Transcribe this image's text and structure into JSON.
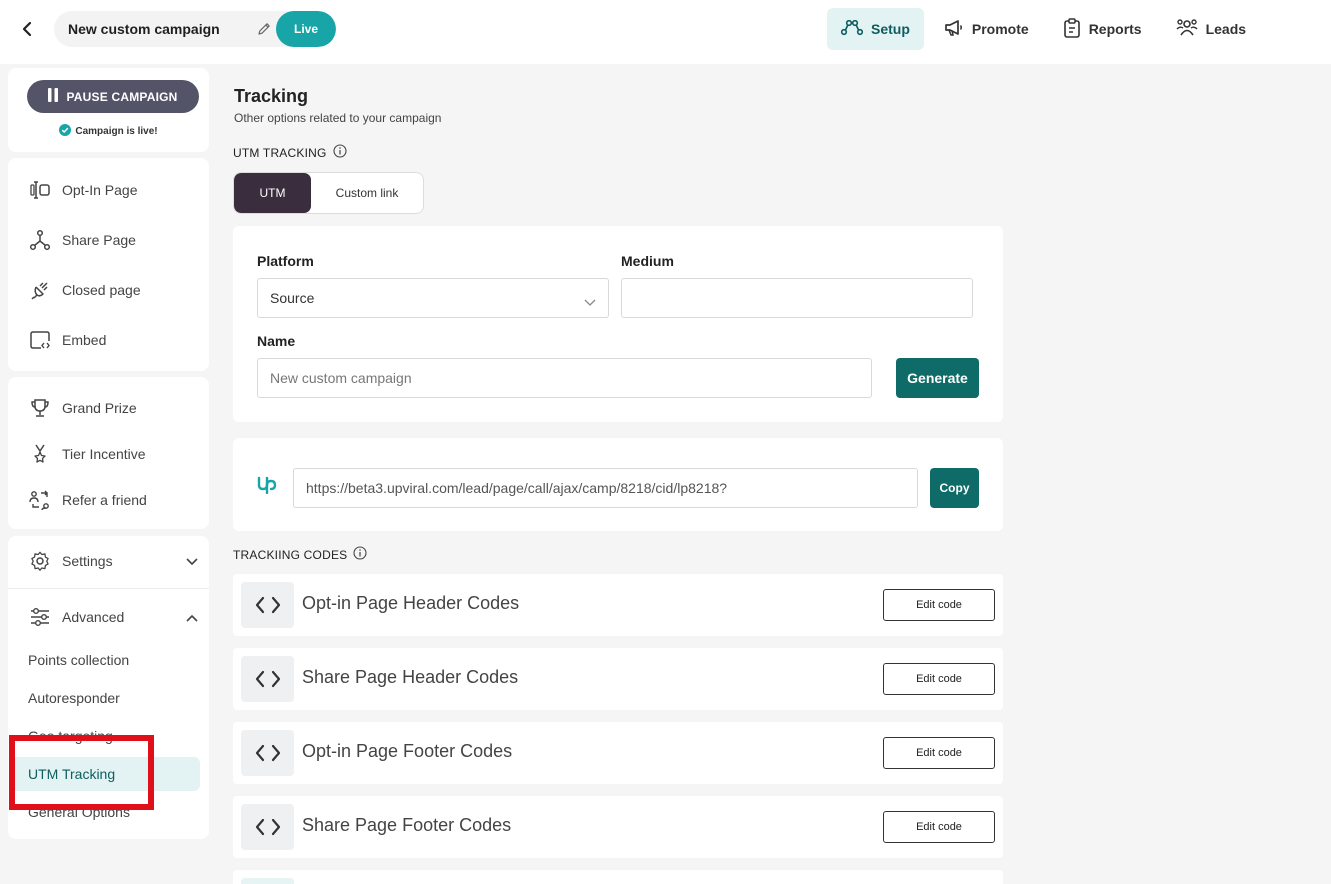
{
  "header": {
    "campaign_name": "New custom campaign",
    "live_label": "Live",
    "nav": [
      {
        "label": "Setup",
        "icon": "setup-icon",
        "active": true
      },
      {
        "label": "Promote",
        "icon": "megaphone-icon"
      },
      {
        "label": "Reports",
        "icon": "clipboard-icon"
      },
      {
        "label": "Leads",
        "icon": "people-icon"
      }
    ]
  },
  "sidebar": {
    "pause_label": "PAUSE CAMPAIGN",
    "live_note": "Campaign is live!",
    "pages": [
      "Opt-In Page",
      "Share Page",
      "Closed page",
      "Embed"
    ],
    "rewards": [
      "Grand Prize",
      "Tier Incentive",
      "Refer a friend"
    ],
    "settings_label": "Settings",
    "advanced_label": "Advanced",
    "advanced_items": [
      "Points collection",
      "Autoresponder",
      "Geo targeting",
      "UTM Tracking",
      "General Options"
    ]
  },
  "main": {
    "title": "Tracking",
    "subtitle": "Other options related to your campaign",
    "utm_section_label": "UTM TRACKING",
    "toggle": {
      "on": "UTM",
      "off": "Custom link"
    },
    "form": {
      "platform_label": "Platform",
      "platform_value": "Source",
      "medium_label": "Medium",
      "medium_value": "",
      "name_label": "Name",
      "name_placeholder": "New custom campaign",
      "generate_label": "Generate"
    },
    "link": {
      "url": "https://beta3.upviral.com/lead/page/call/ajax/camp/8218/cid/lp8218?",
      "copy_label": "Copy"
    },
    "codes_section_label": "TRACKIING CODES",
    "codes": [
      {
        "title": "Opt-in Page Header Codes",
        "button": "Edit code"
      },
      {
        "title": "Share Page Header Codes",
        "button": "Edit code"
      },
      {
        "title": "Opt-in Page Footer Codes",
        "button": "Edit code"
      },
      {
        "title": "Share Page Footer Codes",
        "button": "Edit code"
      }
    ]
  },
  "colors": {
    "accent": "#0e6b68",
    "live": "#17a5a8",
    "highlight_box": "#e0101a"
  }
}
